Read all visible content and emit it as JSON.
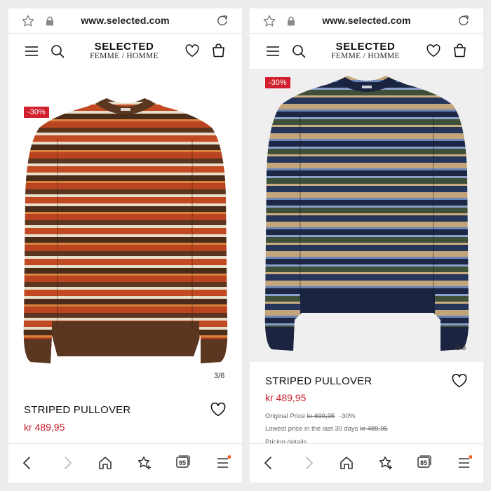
{
  "browser": {
    "url": "www.selected.com",
    "tab_count": "85"
  },
  "site": {
    "brand": "SELECTED",
    "brand_sub": "FEMME / HOMME"
  },
  "colors": {
    "accent_red": "#d11f2e",
    "price_red": "#c8202e"
  },
  "products": [
    {
      "discount_badge": "-30%",
      "image_counter": "3/6",
      "name": "STRIPED PULLOVER",
      "price": "kr 489,95",
      "colorway": "rust-brown-cream"
    },
    {
      "discount_badge": "-30%",
      "image_counter": "3/6",
      "name": "STRIPED PULLOVER",
      "price": "kr 489,95",
      "original_price_label": "Original Price",
      "original_price": "kr 699,95",
      "original_discount": "-30%",
      "lowest_price_label": "Lowest price in the last 30 days",
      "lowest_price": "kr 489,95",
      "pricing_details": "Pricing details",
      "colorway": "navy-green-beige-blue"
    }
  ],
  "icons": {
    "star": "star-icon",
    "lock": "lock-icon",
    "reload": "reload-icon",
    "menu": "hamburger-menu-icon",
    "search": "search-icon",
    "heart": "heart-icon",
    "bag": "shopping-bag-icon",
    "back": "back-arrow-icon",
    "forward": "forward-arrow-icon",
    "home": "home-icon",
    "favorites": "favorites-icon",
    "tabs": "tabs-icon",
    "more": "menu-icon"
  }
}
